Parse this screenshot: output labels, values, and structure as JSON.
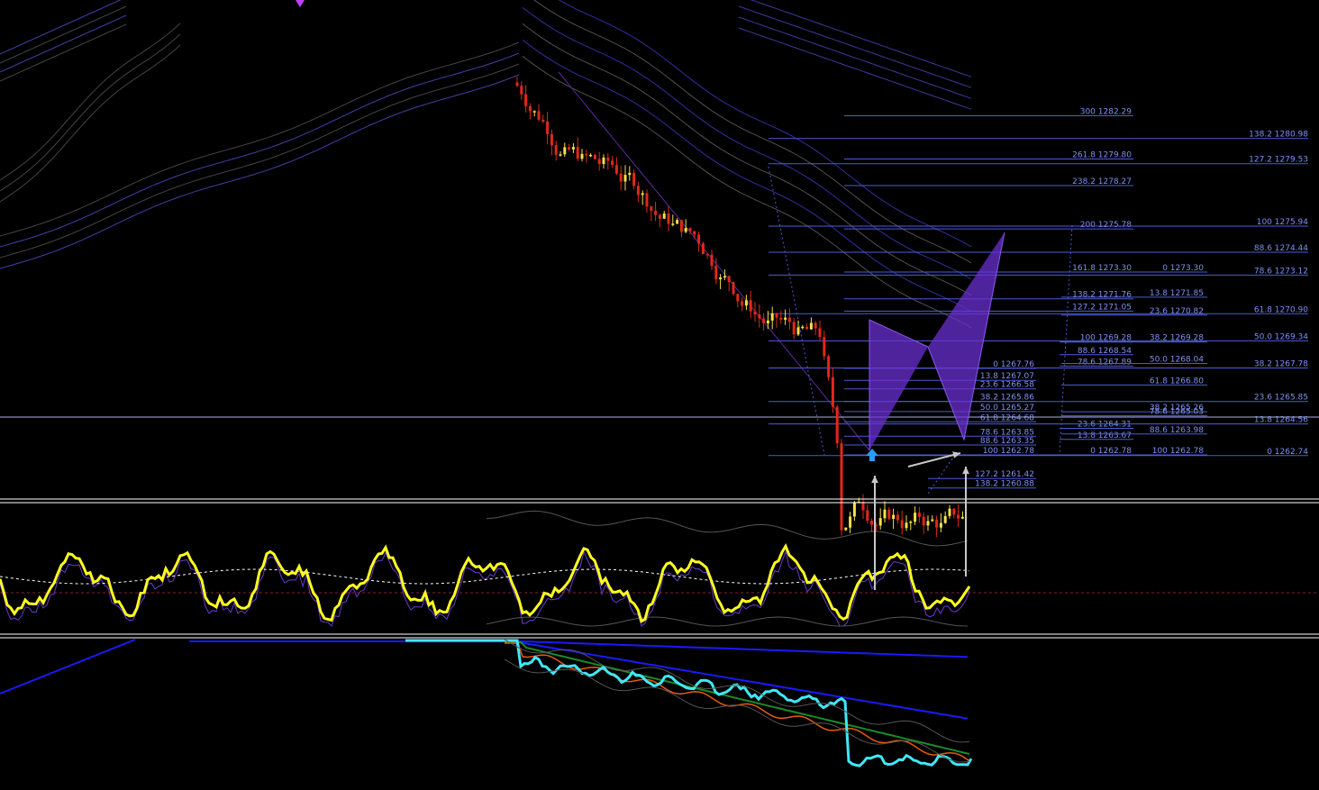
{
  "colors": {
    "background": "#000000",
    "fib_line": "#4b5bd6",
    "fib_text": "#7f8ff0",
    "bull_candle": "#f5e04a",
    "bear_candle": "#e02818",
    "oscillator": "#ffff20",
    "pattern_fill": "#6a2fd0",
    "separator": "#ffffff",
    "arrow": "#c8c8c8",
    "marker": "#2a9df4",
    "cyan_line": "#40e8f8",
    "blue_line": "#1a1aff"
  },
  "fib_levels": [
    {
      "label": "300 1282.29",
      "price": 1282.29,
      "group": "A"
    },
    {
      "label": "261.8 1279.80",
      "price": 1279.8,
      "group": "A"
    },
    {
      "label": "238.2 1278.27",
      "price": 1278.27,
      "group": "A"
    },
    {
      "label": "200 1275.78",
      "price": 1275.78,
      "group": "A"
    },
    {
      "label": "161.8 1273.30",
      "price": 1273.3,
      "group": "A"
    },
    {
      "label": "138.2 1271.76",
      "price": 1271.76,
      "group": "A"
    },
    {
      "label": "127.2 1271.05",
      "price": 1271.05,
      "group": "A"
    },
    {
      "label": "100 1269.28",
      "price": 1269.28,
      "group": "A"
    },
    {
      "label": "88.6 1268.54",
      "price": 1268.54,
      "group": "A"
    },
    {
      "label": "78.6 1267.89",
      "price": 1267.89,
      "group": "A"
    },
    {
      "label": "23.6 1264.31",
      "price": 1264.31,
      "group": "A"
    },
    {
      "label": "13.8 1263.67",
      "price": 1263.67,
      "group": "A"
    },
    {
      "label": "0 1262.78",
      "price": 1262.78,
      "group": "A"
    },
    {
      "label": "0 1267.76",
      "price": 1267.76,
      "group": "B"
    },
    {
      "label": "13.8 1267.07",
      "price": 1267.07,
      "group": "B"
    },
    {
      "label": "23.6 1266.58",
      "price": 1266.58,
      "group": "B"
    },
    {
      "label": "38.2 1265.86",
      "price": 1265.86,
      "group": "B"
    },
    {
      "label": "50.0 1265.27",
      "price": 1265.27,
      "group": "B"
    },
    {
      "label": "61.8 1264.68",
      "price": 1264.68,
      "group": "B"
    },
    {
      "label": "78.6 1263.85",
      "price": 1263.85,
      "group": "B"
    },
    {
      "label": "88.6 1263.35",
      "price": 1263.35,
      "group": "B"
    },
    {
      "label": "100 1262.78",
      "price": 1262.78,
      "group": "B"
    },
    {
      "label": "127.2 1261.42",
      "price": 1261.42,
      "group": "B"
    },
    {
      "label": "138.2 1260.88",
      "price": 1260.88,
      "group": "B"
    },
    {
      "label": "0 1273.30",
      "price": 1273.3,
      "group": "C"
    },
    {
      "label": "13.8 1271.85",
      "price": 1271.85,
      "group": "C"
    },
    {
      "label": "23.6 1270.82",
      "price": 1270.82,
      "group": "C"
    },
    {
      "label": "38.2 1269.28",
      "price": 1269.28,
      "group": "C"
    },
    {
      "label": "50.0 1268.04",
      "price": 1268.04,
      "group": "C"
    },
    {
      "label": "61.8 1266.80",
      "price": 1266.8,
      "group": "C"
    },
    {
      "label": "38.2 1265.26",
      "price": 1265.26,
      "group": "C"
    },
    {
      "label": "78.6 1265.03",
      "price": 1265.03,
      "group": "C"
    },
    {
      "label": "88.6 1263.98",
      "price": 1263.98,
      "group": "C"
    },
    {
      "label": "100 1262.78",
      "price": 1262.78,
      "group": "C"
    },
    {
      "label": "138.2 1280.98",
      "price": 1280.98,
      "group": "D"
    },
    {
      "label": "127.2 1279.53",
      "price": 1279.53,
      "group": "D"
    },
    {
      "label": "100 1275.94",
      "price": 1275.94,
      "group": "D"
    },
    {
      "label": "88.6 1274.44",
      "price": 1274.44,
      "group": "D"
    },
    {
      "label": "78.6 1273.12",
      "price": 1273.12,
      "group": "D"
    },
    {
      "label": "61.8 1270.90",
      "price": 1270.9,
      "group": "D"
    },
    {
      "label": "50.0 1269.34",
      "price": 1269.34,
      "group": "D"
    },
    {
      "label": "38.2 1267.78",
      "price": 1267.78,
      "group": "D"
    },
    {
      "label": "23.6 1265.85",
      "price": 1265.85,
      "group": "D"
    },
    {
      "label": "13.8 1264.56",
      "price": 1264.56,
      "group": "D"
    },
    {
      "label": "0 1262.74",
      "price": 1262.74,
      "group": "D"
    }
  ],
  "icons": {
    "pattern_low_marker": "up-arrow-marker-icon",
    "top_signal_marker": "signal-marker-icon"
  },
  "chart_data": {
    "type": "candlestick",
    "title": "",
    "pattern": "harmonic",
    "price_levels_shown": [
      1282.29,
      1262.74
    ],
    "separators": 2,
    "indicator_panes": [
      "oscillator",
      "moving-averages"
    ]
  }
}
